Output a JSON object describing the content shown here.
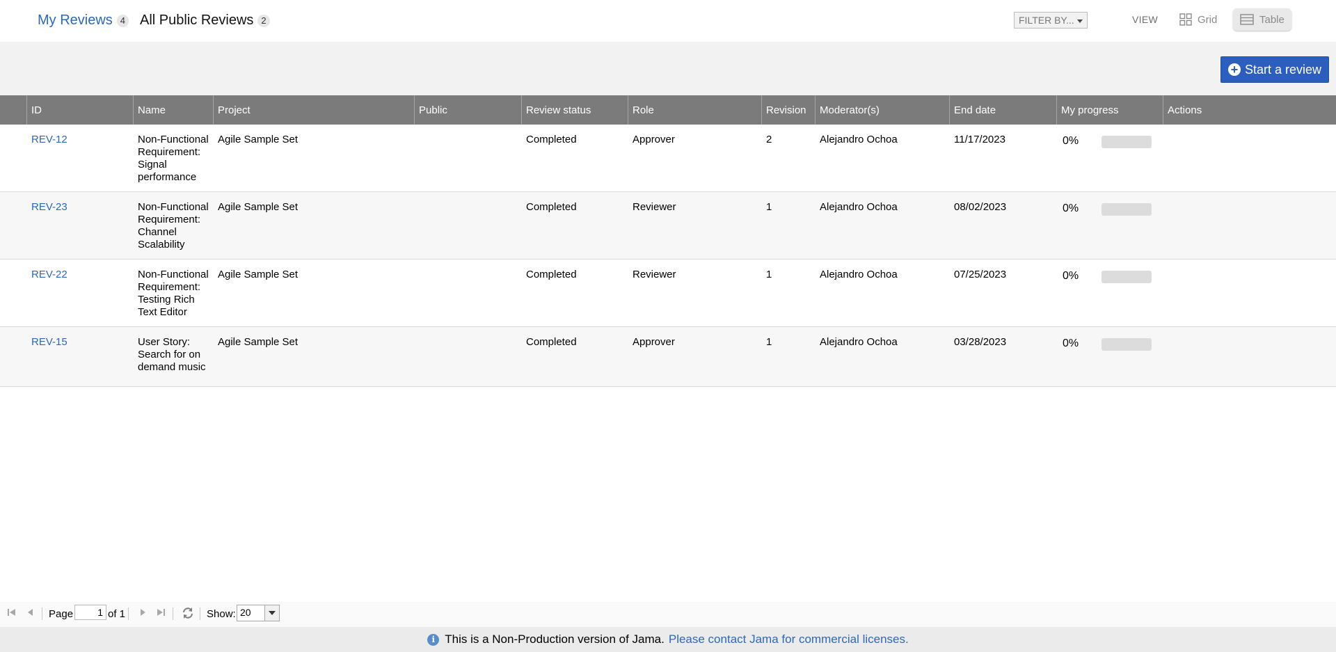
{
  "tabs": [
    {
      "label": "My Reviews",
      "count": "4"
    },
    {
      "label": "All Public Reviews",
      "count": "2"
    }
  ],
  "filter": {
    "label": "FILTER BY..."
  },
  "view": {
    "label": "VIEW",
    "grid_label": "Grid",
    "table_label": "Table",
    "selected": "Table"
  },
  "toolbar": {
    "start_review_label": "Start a review"
  },
  "table": {
    "columns": [
      "",
      "ID",
      "Name",
      "Project",
      "Public",
      "Review status",
      "Role",
      "Revision",
      "Moderator(s)",
      "End date",
      "My progress",
      "Actions"
    ],
    "rows": [
      {
        "id": "REV-12",
        "name": "Non-Functional Requirement: Signal performance",
        "project": "Agile Sample Set",
        "public": "",
        "status": "Completed",
        "role": "Approver",
        "revision": "2",
        "moderator": "Alejandro Ochoa",
        "end_date": "11/17/2023",
        "progress": "0%",
        "actions": ""
      },
      {
        "id": "REV-23",
        "name": "Non-Functional Requirement: Channel Scalability",
        "project": "Agile Sample Set",
        "public": "",
        "status": "Completed",
        "role": "Reviewer",
        "revision": "1",
        "moderator": "Alejandro Ochoa",
        "end_date": "08/02/2023",
        "progress": "0%",
        "actions": ""
      },
      {
        "id": "REV-22",
        "name": "Non-Functional Requirement: Testing Rich Text Editor",
        "project": "Agile Sample Set",
        "public": "",
        "status": "Completed",
        "role": "Reviewer",
        "revision": "1",
        "moderator": "Alejandro Ochoa",
        "end_date": "07/25/2023",
        "progress": "0%",
        "actions": ""
      },
      {
        "id": "REV-15",
        "name": "User Story: Search for on demand music",
        "project": "Agile Sample Set",
        "public": "",
        "status": "Completed",
        "role": "Approver",
        "revision": "1",
        "moderator": "Alejandro Ochoa",
        "end_date": "03/28/2023",
        "progress": "0%",
        "actions": ""
      }
    ]
  },
  "pager": {
    "page_label": "Page",
    "page_value": "1",
    "of_label": "of 1",
    "show_label": "Show:",
    "show_value": "20"
  },
  "footer": {
    "notice": "This is a Non-Production version of Jama.",
    "link": "Please contact Jama for commercial licenses."
  },
  "icons": {
    "info": "info-icon",
    "first": "first-page-icon",
    "prev": "prev-page-icon",
    "next": "next-page-icon",
    "last": "last-page-icon",
    "refresh": "refresh-icon",
    "grid": "grid-icon",
    "table": "table-icon",
    "plus": "plus-circle-icon"
  },
  "colors": {
    "accent": "#2c68b8",
    "primary_button": "#2c5fbd",
    "header_bar": "#7b7b7b"
  }
}
